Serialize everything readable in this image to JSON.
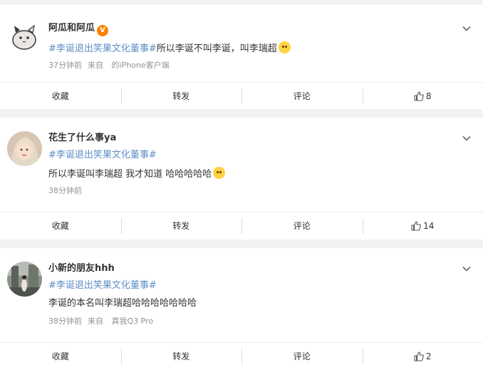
{
  "posts": [
    {
      "username": "阿瓜和阿瓜",
      "verified": "V",
      "topic": "#李诞退出笑果文化董事#",
      "text": "所以李诞不叫李诞，叫李瑞超",
      "time": "37分钟前",
      "source_prefix": "来自",
      "source": "的iPhone客户端",
      "actions": {
        "collect": "收藏",
        "repost": "转发",
        "comment": "评论",
        "likes": "8"
      }
    },
    {
      "username": "花生了什么事ya",
      "topic": "#李诞退出笑果文化董事#",
      "text": "所以李诞叫李瑞超 我才知道 哈哈哈哈哈",
      "time": "38分钟前",
      "actions": {
        "collect": "收藏",
        "repost": "转发",
        "comment": "评论",
        "likes": "14"
      }
    },
    {
      "username": "小新的朋友hhh",
      "topic": "#李诞退出笑果文化董事#",
      "text": "李诞的本名叫李瑞超哈哈哈哈哈哈哈",
      "time": "38分钟前",
      "source_prefix": "来自",
      "source": "真我Q3 Pro",
      "actions": {
        "collect": "收藏",
        "repost": "转发",
        "comment": "评论",
        "likes": "2"
      }
    }
  ],
  "colors": {
    "topic_link": "#5d8ec6",
    "verified_badge": "#ff8200",
    "meta": "#939393"
  },
  "icons": [
    "chevron-down-icon",
    "thumbs-up-icon",
    "emoji-icon",
    "verified-badge-icon"
  ]
}
